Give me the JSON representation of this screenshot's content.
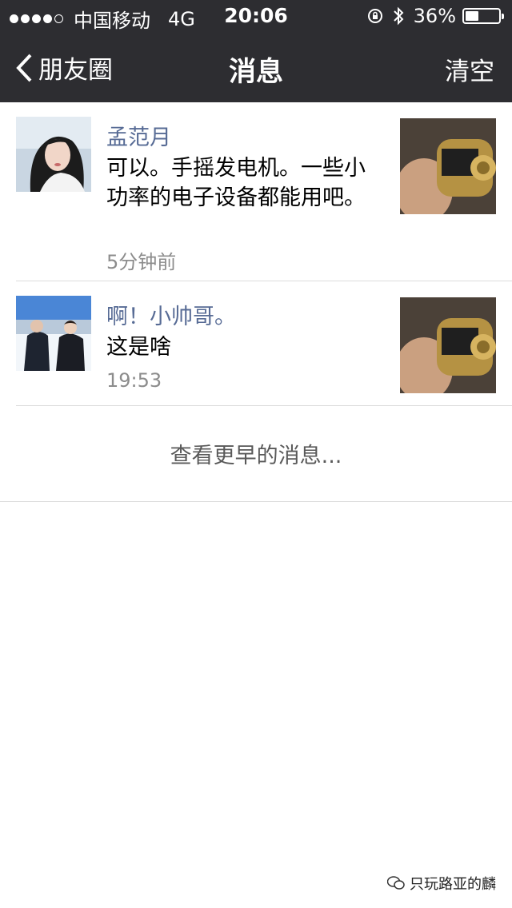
{
  "status_bar": {
    "carrier": "中国移动",
    "network": "4G",
    "time": "20:06",
    "battery": "36%",
    "battery_level": 0.36
  },
  "nav": {
    "back_label": "朋友圈",
    "title": "消息",
    "clear_label": "清空"
  },
  "messages": [
    {
      "name": "孟范月",
      "content": "可以。手摇发电机。一些小功率的电子设备都能用吧。",
      "time": "5分钟前"
    },
    {
      "name": "啊！小帅哥。",
      "content": "这是啥",
      "time": "19:53"
    }
  ],
  "more_label": "查看更早的消息...",
  "watermark": "只玩路亚的麟",
  "colors": {
    "bar_bg": "#2d2d31",
    "name_link": "#576b95",
    "timestamp": "#8c8c8c"
  }
}
